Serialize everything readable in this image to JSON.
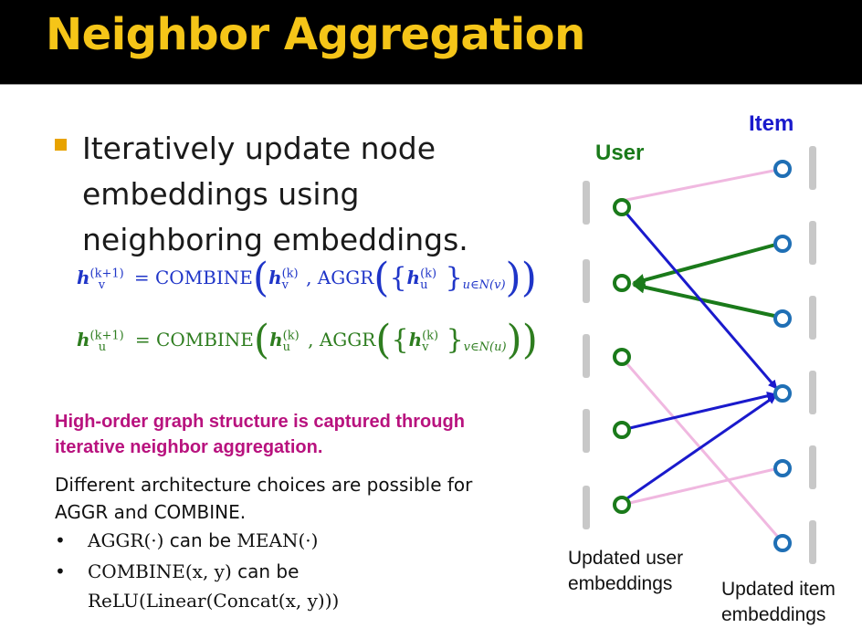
{
  "title": "Neighbor Aggregation",
  "bullet": "Iteratively update node embeddings using neighboring embeddings.",
  "formulas": {
    "user_lhs": "h",
    "user_lhs_sup": "(k+1)",
    "user_lhs_sub": "v",
    "combine": "= COMBINE",
    "aggr": "AGGR",
    "user_self": "h",
    "user_self_sup": "(k)",
    "user_self_sub": "v",
    "user_nbr": "h",
    "user_nbr_sup": "(k)",
    "user_nbr_sub": "u",
    "user_set_sub": "u∈N(v)",
    "item_lhs": "h",
    "item_lhs_sup": "(k+1)",
    "item_lhs_sub": "u",
    "item_self": "h",
    "item_self_sup": "(k)",
    "item_self_sub": "u",
    "item_nbr": "h",
    "item_nbr_sup": "(k)",
    "item_nbr_sub": "v",
    "item_set_sub": "v∈N(u)"
  },
  "highlight": "High-order graph structure is captured through iterative neighbor aggregation.",
  "note": "Different architecture choices are possible for AGGR and COMBINE.",
  "list": {
    "bullet_char": "•",
    "item1_code": "AGGR(·)",
    "item1_mid": " can be ",
    "item1_code2": "MEAN(·)",
    "item2_code": "COMBINE(x, y)",
    "item2_mid": " can be",
    "item2_cont": "ReLU(Linear(Concat(x, y)))"
  },
  "graph": {
    "user_label": "User",
    "item_label": "Item",
    "user_caption": "Updated user embeddings",
    "item_caption": "Updated item embeddings",
    "colors": {
      "user": "#1a7a1a",
      "item": "#1f6fb5",
      "blue_arrow": "#1a1acc",
      "green_arrow": "#1a7a1a",
      "pink_edge": "#f0b8e0",
      "bar": "#c8c8c8"
    }
  }
}
